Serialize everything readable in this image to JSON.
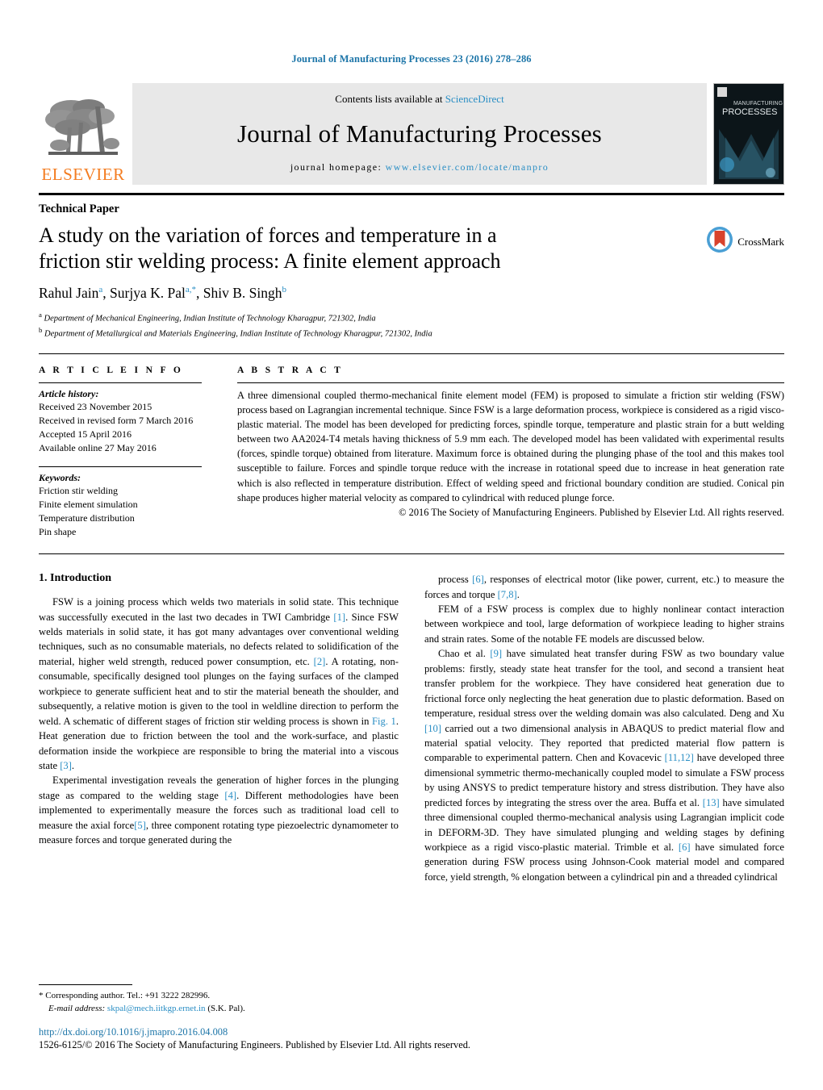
{
  "running_head": "Journal of Manufacturing Processes 23 (2016) 278–286",
  "masthead": {
    "publisher": "ELSEVIER",
    "contents_prefix": "Contents lists available at ",
    "contents_link": "ScienceDirect",
    "journal_title": "Journal of Manufacturing Processes",
    "homepage_label": "journal homepage:",
    "homepage_url": "www.elsevier.com/locate/manpro",
    "cover_line1": "MANUFACTURING",
    "cover_line2": "PROCESSES"
  },
  "article": {
    "type": "Technical Paper",
    "title": "A study on the variation of forces and temperature in a friction stir welding process: A finite element approach",
    "authors": [
      {
        "name": "Rahul Jain",
        "marks": "a"
      },
      {
        "name": "Surjya K. Pal",
        "marks": "a,*"
      },
      {
        "name": "Shiv B. Singh",
        "marks": "b"
      }
    ],
    "affiliations": [
      {
        "mark": "a",
        "text": "Department of Mechanical Engineering, Indian Institute of Technology Kharagpur, 721302, India"
      },
      {
        "mark": "b",
        "text": "Department of Metallurgical and Materials Engineering, Indian Institute of Technology Kharagpur, 721302, India"
      }
    ],
    "crossmark_label": "CrossMark"
  },
  "info": {
    "heading": "A R T I C L E    I N F O",
    "history_label": "Article history:",
    "history": [
      "Received 23 November 2015",
      "Received in revised form 7 March 2016",
      "Accepted 15 April 2016",
      "Available online 27 May 2016"
    ],
    "keywords_label": "Keywords:",
    "keywords": [
      "Friction stir welding",
      "Finite element simulation",
      "Temperature distribution",
      "Pin shape"
    ]
  },
  "abstract": {
    "heading": "A B S T R A C T",
    "text": "A three dimensional coupled thermo-mechanical finite element model (FEM) is proposed to simulate a friction stir welding (FSW) process based on Lagrangian incremental technique. Since FSW is a large deformation process, workpiece is considered as a rigid visco-plastic material. The model has been developed for predicting forces, spindle torque, temperature and plastic strain for a butt welding between two AA2024-T4 metals having thickness of 5.9 mm each. The developed model has been validated with experimental results (forces, spindle torque) obtained from literature. Maximum force is obtained during the plunging phase of the tool and this makes tool susceptible to failure. Forces and spindle torque reduce with the increase in rotational speed due to increase in heat generation rate which is also reflected in temperature distribution. Effect of welding speed and frictional boundary condition are studied. Conical pin shape produces higher material velocity as compared to cylindrical with reduced plunge force.",
    "copyright": "© 2016 The Society of Manufacturing Engineers. Published by Elsevier Ltd. All rights reserved."
  },
  "body": {
    "section_title": "1.  Introduction",
    "left_paragraphs": [
      "FSW is a joining process which welds two materials in solid state. This technique was successfully executed in the last two decades in TWI Cambridge [1]. Since FSW welds materials in solid state, it has got many advantages over conventional welding techniques, such as no consumable materials, no defects related to solidification of the material, higher weld strength, reduced power consumption, etc. [2]. A rotating, non-consumable, specifically designed tool plunges on the faying surfaces of the clamped workpiece to generate sufficient heat and to stir the material beneath the shoulder, and subsequently, a relative motion is given to the tool in weldline direction to perform the weld. A schematic of different stages of friction stir welding process is shown in Fig. 1. Heat generation due to friction between the tool and the work-surface, and plastic deformation inside the workpiece are responsible to bring the material into a viscous state [3].",
      "Experimental investigation reveals the generation of higher forces in the plunging stage as compared to the welding stage [4]. Different methodologies have been implemented to experimentally measure the forces such as traditional load cell to measure the axial force[5], three component rotating type piezoelectric dynamometer to measure forces and torque generated during the"
    ],
    "right_paragraphs": [
      "process [6], responses of electrical motor (like power, current, etc.) to measure the forces and torque [7,8].",
      "FEM of a FSW process is complex due to highly nonlinear contact interaction between workpiece and tool, large deformation of workpiece leading to higher strains and strain rates. Some of the notable FE models are discussed below.",
      "Chao et al. [9] have simulated heat transfer during FSW as two boundary value problems: firstly, steady state heat transfer for the tool, and second a transient heat transfer problem for the workpiece. They have considered heat generation due to frictional force only neglecting the heat generation due to plastic deformation. Based on temperature, residual stress over the welding domain was also calculated. Deng and Xu [10] carried out a two dimensional analysis in ABAQUS to predict material flow and material spatial velocity. They reported that predicted material flow pattern is comparable to experimental pattern. Chen and Kovacevic [11,12] have developed three dimensional symmetric thermo-mechanically coupled model to simulate a FSW process by using ANSYS to predict temperature history and stress distribution. They have also predicted forces by integrating the stress over the area. Buffa et al. [13] have simulated three dimensional coupled thermo-mechanical analysis using Lagrangian implicit code in DEFORM-3D. They have simulated plunging and welding stages by defining workpiece as a rigid visco-plastic material. Trimble et al. [6] have simulated force generation during FSW process using Johnson-Cook material model and compared force, yield strength, % elongation between a cylindrical pin and a threaded cylindrical"
    ]
  },
  "footnote": {
    "star": "*",
    "corresponding": "Corresponding author. Tel.: +91 3222 282996.",
    "email_label": "E-mail address:",
    "email": "skpal@mech.iitkgp.ernet.in",
    "email_suffix": "(S.K. Pal)."
  },
  "footer": {
    "doi": "http://dx.doi.org/10.1016/j.jmapro.2016.04.008",
    "issn": "1526-6125/© 2016 The Society of Manufacturing Engineers. Published by Elsevier Ltd. All rights reserved."
  },
  "colors": {
    "link": "#2a8ec4",
    "running_head": "#1c75a8",
    "elsevier_orange": "#f47c20",
    "crossmark_blue": "#4a9fd4",
    "crossmark_red": "#d8422c"
  }
}
